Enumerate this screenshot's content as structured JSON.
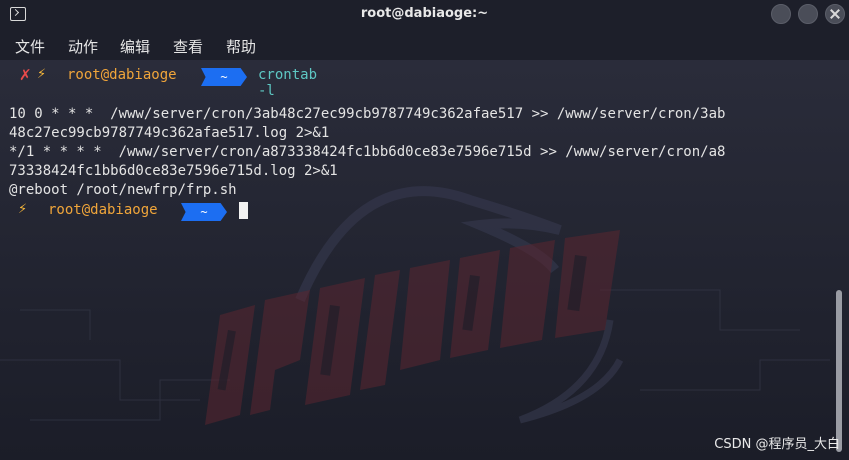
{
  "window": {
    "title": "root@dabiaoge:~",
    "buttons": [
      "minimize",
      "maximize",
      "close"
    ]
  },
  "menu": [
    {
      "label": "文件"
    },
    {
      "label": "动作"
    },
    {
      "label": "编辑"
    },
    {
      "label": "查看"
    },
    {
      "label": "帮助"
    }
  ],
  "prompt1": {
    "status_icon": "✗",
    "bolt": "⚡",
    "user": "root@dabiaoge",
    "dir": "~",
    "command": "crontab -l"
  },
  "output": [
    "10 0 * * *  /www/server/cron/3ab48c27ec99cb9787749c362afae517 >> /www/server/cron/3ab",
    "48c27ec99cb9787749c362afae517.log 2>&1",
    "*/1 * * * *  /www/server/cron/a873338424fc1bb6d0ce83e7596e715d >> /www/server/cron/a8",
    "73338424fc1bb6d0ce83e7596e715d.log 2>&1",
    "@reboot /root/newfrp/frp.sh"
  ],
  "prompt2": {
    "bolt": "⚡",
    "user": "root@dabiaoge",
    "dir": "~"
  },
  "watermark": "CSDN @程序员_大白",
  "colors": {
    "background": "#222431",
    "titlebar": "#1d1f2a",
    "prompt_user": "#f0a53a",
    "prompt_dir_bg": "#1c6ef2",
    "command": "#5ec8c4",
    "error_x": "#e84a4a"
  }
}
